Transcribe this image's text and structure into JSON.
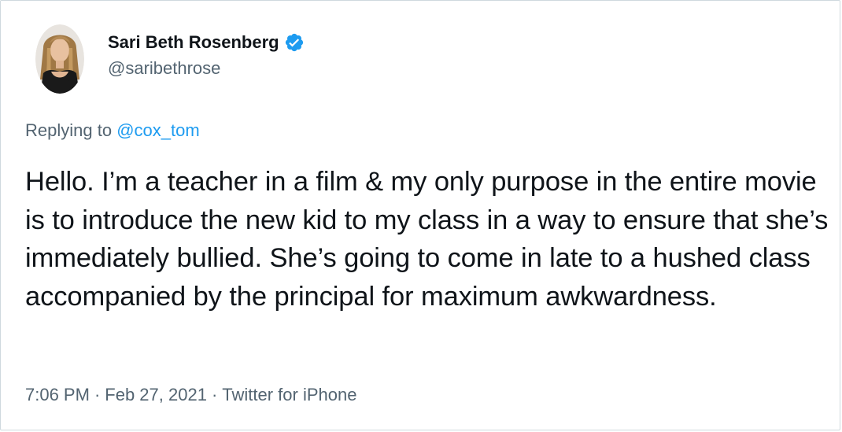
{
  "author": {
    "display_name": "Sari Beth Rosenberg",
    "handle": "@saribethrose",
    "verified": true
  },
  "reply": {
    "prefix": "Replying to",
    "to_handle": "@cox_tom"
  },
  "tweet": {
    "text": "Hello. I’m a teacher in a film & my only purpose in the entire movie is to introduce the new kid to my class in a way to ensure that she’s immediately bullied. She’s going to come in late to a hushed class accompanied by the principal for maximum awkwardness."
  },
  "meta": {
    "time": "7:06 PM",
    "date": "Feb 27, 2021",
    "source": "Twitter for iPhone",
    "separator": "·"
  },
  "colors": {
    "link": "#1d9bf0",
    "secondary_text": "#536471",
    "primary_text": "#0f1419",
    "verified_badge": "#1d9bf0"
  },
  "icons": {
    "verified": "verified-badge-icon"
  }
}
